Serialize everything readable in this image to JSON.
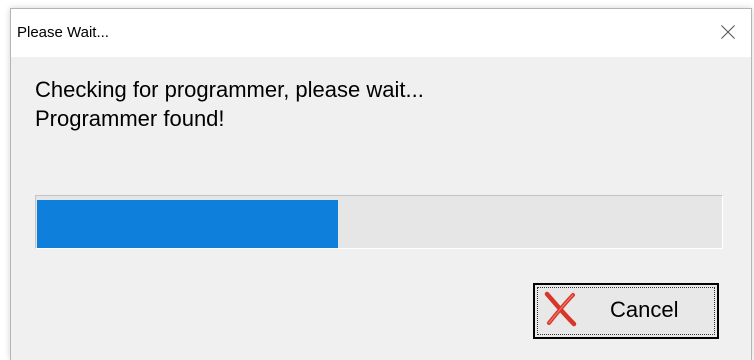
{
  "window": {
    "title": "Please Wait..."
  },
  "message": {
    "line1": "Checking for programmer, please wait...",
    "line2": "Programmer found!"
  },
  "progress": {
    "fraction": 0.44,
    "fill_color": "#0f7fdc"
  },
  "buttons": {
    "cancel_label": "Cancel",
    "cancel_icon": "red-x-icon",
    "close_icon": "close-icon"
  }
}
